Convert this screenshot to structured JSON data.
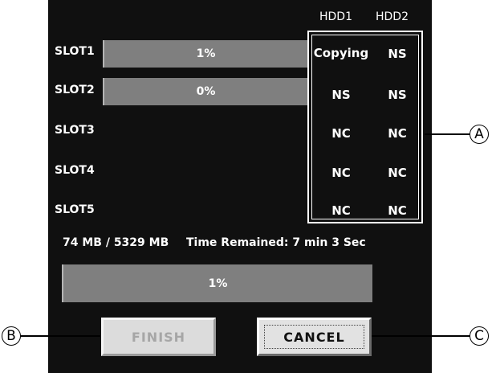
{
  "headers": {
    "hdd1": "HDD1",
    "hdd2": "HDD2"
  },
  "slots": [
    {
      "label": "SLOT1",
      "progress_text": "1%",
      "progress": 1,
      "hdd1": "Copying",
      "hdd2": "NS"
    },
    {
      "label": "SLOT2",
      "progress_text": "0%",
      "progress": 0,
      "hdd1": "NS",
      "hdd2": "NS"
    },
    {
      "label": "SLOT3",
      "hdd1": "NC",
      "hdd2": "NC"
    },
    {
      "label": "SLOT4",
      "hdd1": "NC",
      "hdd2": "NC"
    },
    {
      "label": "SLOT5",
      "hdd1": "NC",
      "hdd2": "NC"
    }
  ],
  "status": {
    "size_text": "74 MB / 5329 MB",
    "time_text": "Time Remained: 7 min 3  Sec"
  },
  "overall": {
    "progress_text": "1%",
    "progress": 1
  },
  "buttons": {
    "finish": "FINISH",
    "cancel": "CANCEL"
  },
  "callouts": {
    "a": "A",
    "b": "B",
    "c": "C"
  },
  "colors": {
    "background": "#101010",
    "bar": "#7f7f7f",
    "text": "#ffffff"
  }
}
